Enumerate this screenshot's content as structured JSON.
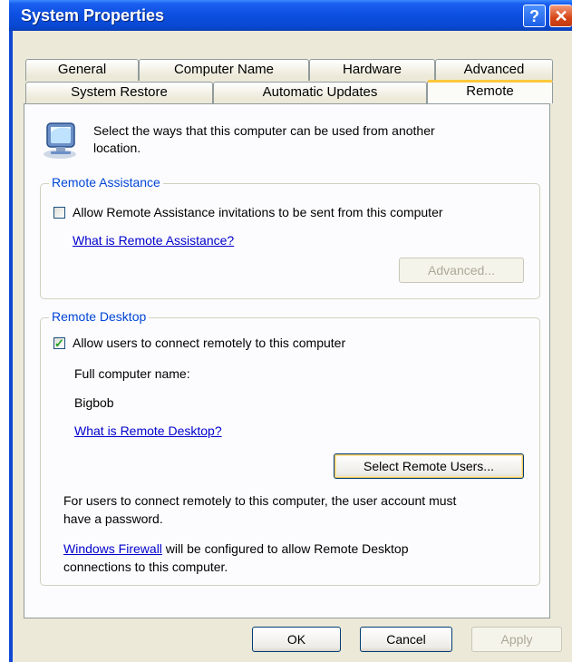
{
  "window": {
    "title": "System Properties",
    "help_glyph": "?",
    "close_glyph": "✕"
  },
  "tabs": {
    "row1": [
      {
        "label": "General"
      },
      {
        "label": "Computer Name"
      },
      {
        "label": "Hardware"
      },
      {
        "label": "Advanced"
      }
    ],
    "row2": [
      {
        "label": "System Restore"
      },
      {
        "label": "Automatic Updates"
      },
      {
        "label": "Remote",
        "active": true
      }
    ]
  },
  "intro": {
    "icon": "computer-monitor-icon",
    "line1": "Select the ways that this computer can be used from another",
    "line2": "location."
  },
  "remote_assistance": {
    "legend": "Remote Assistance",
    "checkbox_label": "Allow Remote Assistance invitations to be sent from this computer",
    "checked": false,
    "help_link": "What is Remote Assistance?",
    "advanced_button": "Advanced..."
  },
  "remote_desktop": {
    "legend": "Remote Desktop",
    "checkbox_label": "Allow users to connect remotely to this computer",
    "checked": true,
    "computer_name_label": "Full computer name:",
    "computer_name": "Bigbob",
    "help_link": "What is Remote Desktop?",
    "select_users_button": "Select Remote Users...",
    "password_note_line1": "For users to connect remotely to this computer, the user account must",
    "password_note_line2": "have a password.",
    "firewall_link": "Windows Firewall",
    "firewall_note_rest": " will be configured to allow Remote Desktop",
    "firewall_note_line2": "connections to this computer."
  },
  "footer": {
    "ok": "OK",
    "cancel": "Cancel",
    "apply": "Apply"
  },
  "colors": {
    "title_bar": "#0d4fe0",
    "group_legend": "#0046d5",
    "link": "#0000cc",
    "tab_highlight": "#ffc83c"
  }
}
